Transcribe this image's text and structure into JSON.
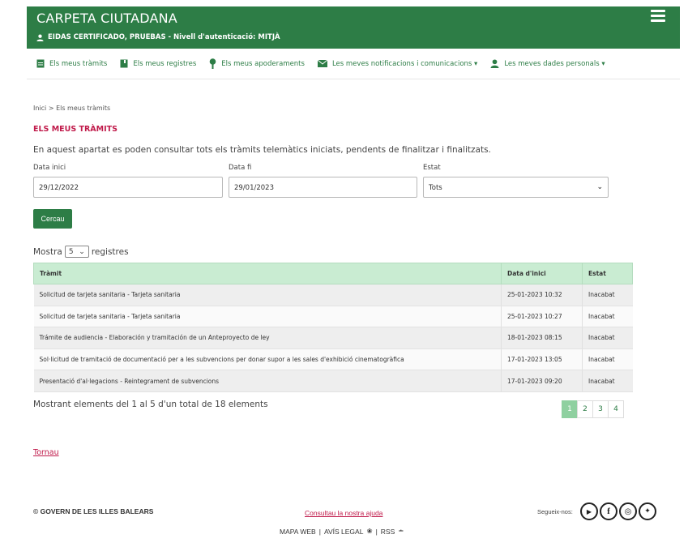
{
  "header": {
    "app_title": "CARPETA CIUTADANA",
    "user_line": "EIDAS CERTIFICADO, PRUEBAS  -  Nivell d'autenticació: MITJÀ"
  },
  "nav": {
    "items": [
      {
        "label": "Els meus tràmits",
        "icon": "document-icon"
      },
      {
        "label": "Els meus registres",
        "icon": "book-icon"
      },
      {
        "label": "Els meus apoderaments",
        "icon": "pin-icon"
      },
      {
        "label": "Les meves notificacions i comunicacions ▾",
        "icon": "envelope-icon"
      },
      {
        "label": "Les meves dades personals ▾",
        "icon": "user-icon"
      }
    ]
  },
  "breadcrumb": "Inici  >  Els meus tràmits",
  "page_title": "ELS MEUS TRÀMITS",
  "intro": "En aquest apartat es poden consultar tots els tràmits telemàtics iniciats, pendents de finalitzar i finalitzats.",
  "filters": {
    "start_label": "Data inici",
    "start_value": "29/12/2022",
    "end_label": "Data fi",
    "end_value": "29/01/2023",
    "state_label": "Estat",
    "state_value": "Tots"
  },
  "search_label": "Cercau",
  "show": {
    "prefix": "Mostra",
    "value": "5",
    "suffix": "registres"
  },
  "table": {
    "headers": [
      "Tràmit",
      "Data d'inici",
      "Estat"
    ],
    "rows": [
      [
        "Solicitud de tarjeta sanitaria - Tarjeta sanitaria",
        "25-01-2023 10:32",
        "Inacabat"
      ],
      [
        "Solicitud de tarjeta sanitaria - Tarjeta sanitaria",
        "25-01-2023 10:27",
        "Inacabat"
      ],
      [
        "Trámite de audiencia - Elaboración y tramitación de un Anteproyecto de ley",
        "18-01-2023 08:15",
        "Inacabat"
      ],
      [
        "Sol·licitud de tramitació de documentació per a les subvencions per donar supor a les sales d'exhibició cinematogràfica",
        "17-01-2023 13:05",
        "Inacabat"
      ],
      [
        "Presentació d'al·legacions - Reintegrament de subvencions",
        "17-01-2023 09:20",
        "Inacabat"
      ]
    ]
  },
  "summary": "Mostrant elements del 1 al 5 d'un total de 18 elements",
  "pages": [
    "1",
    "2",
    "3",
    "4"
  ],
  "back_link": "Tornau",
  "footer": {
    "gov": "© GOVERN DE LES ILLES BALEARS",
    "help": "Consultau la nostra ajuda",
    "map": "MAPA WEB",
    "legal": "AVÍS LEGAL",
    "rss": "RSS",
    "follow": "Segueix-nos:"
  },
  "colors": {
    "primary": "#2d7d46",
    "accent": "#c01a4a",
    "table_header": "#c9ecd2"
  }
}
